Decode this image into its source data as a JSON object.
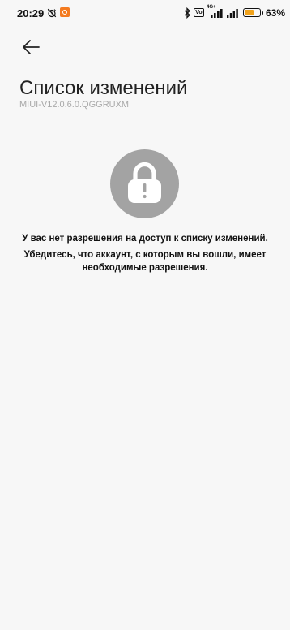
{
  "status_bar": {
    "time": "20:29",
    "icons": [
      "alarm-off-icon",
      "app-notification-icon",
      "bluetooth-icon",
      "volte-icon",
      "signal-4g-icon",
      "signal-icon",
      "battery-icon"
    ],
    "volte_label": "Vo",
    "network_label": "4G+",
    "battery_percent": "63%",
    "battery_level": 0.63,
    "battery_color": "#f0a21b",
    "app_icon_color": "#f47b20"
  },
  "header": {
    "back_icon": "arrow-left-icon",
    "title": "Список изменений",
    "subtitle": "MIUI-V12.0.6.0.QGGRUXM"
  },
  "content": {
    "lock_icon": "lock-icon",
    "lock_color": "#a3a3a3",
    "message_main": "У вас нет разрешения на доступ к списку изменений.",
    "message_hint_line1": "Убедитесь, что аккаунт, с которым вы вошли, имеет",
    "message_hint_line2": "необходимые разрешения."
  }
}
